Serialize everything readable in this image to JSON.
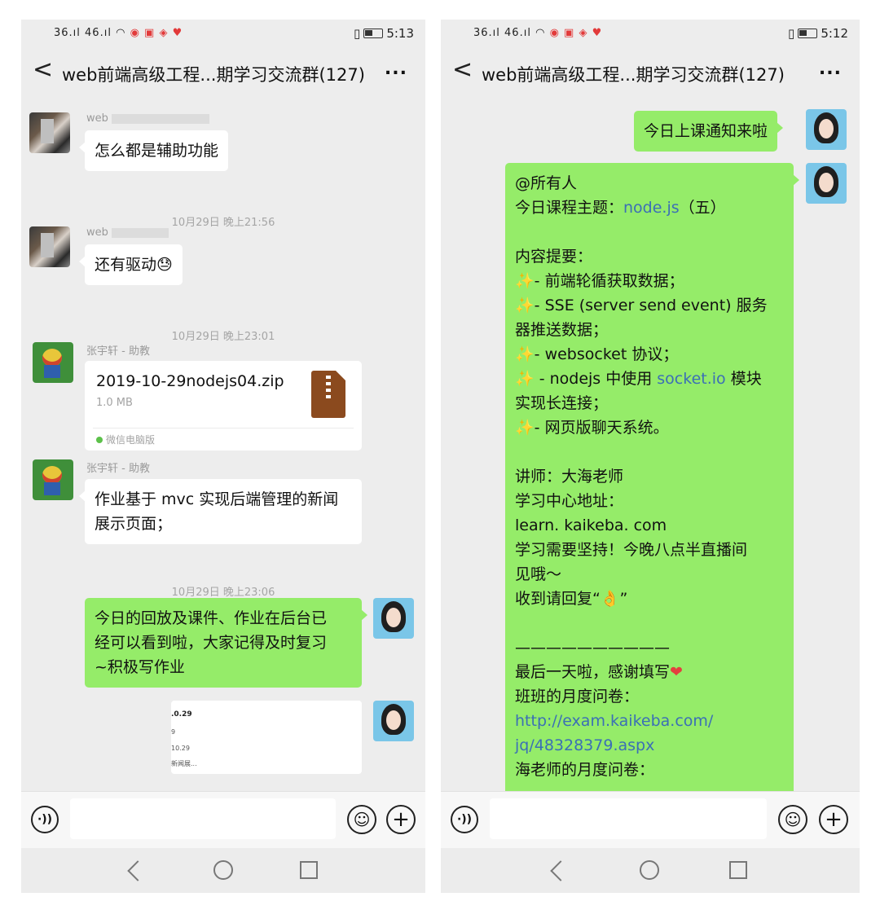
{
  "left": {
    "status": {
      "signal": "36.ıl 46.ıl",
      "time": "5:13"
    },
    "title": "web前端高级工程...期学习交流群(127)",
    "back": "<",
    "more": "...",
    "messages": {
      "m1_sender": "web",
      "m1_text": "怎么都是辅助功能",
      "t1": "10月29日 晚上21:56",
      "m2_sender": "web",
      "m2_text": "还有驱动",
      "m2_emoji": "😓",
      "t2": "10月29日 晚上23:01",
      "m3_sender": "张宇轩 - 助教",
      "file_name": "2019-10-29nodejs04.zip",
      "file_size": "1.0 MB",
      "file_source": "微信电脑版",
      "m4_sender": "张宇轩 - 助教",
      "m4_line1": "作业基于 mvc 实现后端管理的新闻",
      "m4_line2": "展示页面；",
      "t3": "10月29日 晚上23:06",
      "m5_line1": "今日的回放及课件、作业在后台已",
      "m5_line2": "经可以看到啦，大家记得及时复习",
      "m5_line3": "~积极写作业",
      "img_l1": ".0.29",
      "img_l2": "9",
      "img_l3": "10.29",
      "img_l4": "新闻展..."
    }
  },
  "right": {
    "status": {
      "signal": "36.ıl 46.ıl",
      "time": "5:12"
    },
    "title": "web前端高级工程...期学习交流群(127)",
    "back": "<",
    "more": "...",
    "messages": {
      "m1_text": "今日上课通知来啦",
      "lines": {
        "l1": "@所有人",
        "l2a": "今日课程主题：",
        "l2b": "node.js",
        "l2c": "（五）",
        "l3": "内容提要：",
        "spark": "✨",
        "l4": "- 前端轮循获取数据；",
        "l5a": "- SSE (server send event) 服务",
        "l5b": "器推送数据；",
        "l6": "- websocket 协议；",
        "l7a": " - nodejs 中使用 ",
        "l7b": "socket.io",
        "l7c": " 模块",
        "l7d": "实现长连接；",
        "l8": "- 网页版聊天系统。",
        "l9": "讲师：大海老师",
        "l10": "学习中心地址：",
        "l11": "learn. kaikeba. com",
        "l12a": "学习需要坚持！今晚八点半直播间",
        "l12b": "见哦～",
        "l13a": "收到请回复“",
        "l13b": "👌",
        "l13c": "”",
        "l14": "——————————",
        "l15a": "最后一天啦，感谢填写",
        "l15b": "❤",
        "l16": "班班的月度问卷：",
        "l17a": "http://exam.kaikeba.com/",
        "l17b": "jq/48328379.aspx",
        "l18": "海老师的月度问卷："
      }
    }
  },
  "input": {
    "voice": "·))",
    "emoji": "☺",
    "plus": "+"
  }
}
